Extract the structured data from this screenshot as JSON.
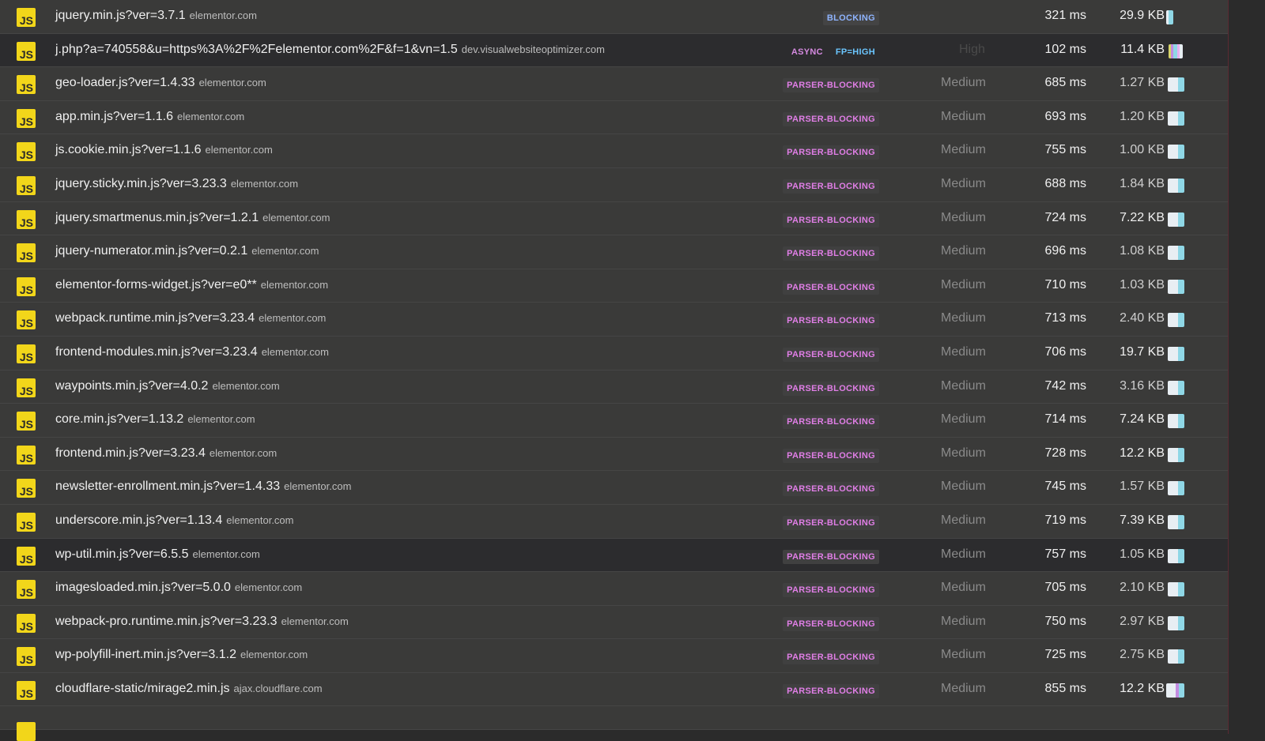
{
  "colors": {
    "js_icon": "#f2d61a",
    "blocking_badge": "#8fb4ff",
    "parser_blocking_badge": "#e07ee6",
    "async_badge": "#d58ae0",
    "fp_badge": "#6bc6ff",
    "bar_light": "#e8eef3",
    "bar_cyan": "#8fd7e6",
    "bar_accent": "#c38be0"
  },
  "icon": "js-file-icon",
  "icon_label": "JS",
  "rows": [
    {
      "name": "jquery.min.js?ver=3.7.1",
      "host": "elementor.com",
      "badges": [
        "BLOCKING"
      ],
      "priority": "",
      "time": "321 ms",
      "size": "29.9 KB",
      "bar": "cyan-thin",
      "highlight": true
    },
    {
      "name": "j.php?a=740558&u=https%3A%2F%2Felementor.com%2F&f=1&vn=1.5",
      "host": "dev.visualwebsiteoptimizer.com",
      "badges": [
        "ASYNC",
        "FP=HIGH"
      ],
      "priority": "High",
      "time": "102 ms",
      "size": "11.4 KB",
      "bar": "multi",
      "dark": true
    },
    {
      "name": "geo-loader.js?ver=1.4.33",
      "host": "elementor.com",
      "badges": [
        "PARSER-BLOCKING"
      ],
      "priority": "Medium",
      "time": "685 ms",
      "size": "1.27 KB",
      "bar": "std"
    },
    {
      "name": "app.min.js?ver=1.1.6",
      "host": "elementor.com",
      "badges": [
        "PARSER-BLOCKING"
      ],
      "priority": "Medium",
      "time": "693 ms",
      "size": "1.20 KB",
      "bar": "std"
    },
    {
      "name": "js.cookie.min.js?ver=1.1.6",
      "host": "elementor.com",
      "badges": [
        "PARSER-BLOCKING"
      ],
      "priority": "Medium",
      "time": "755 ms",
      "size": "1.00 KB",
      "bar": "std"
    },
    {
      "name": "jquery.sticky.min.js?ver=3.23.3",
      "host": "elementor.com",
      "badges": [
        "PARSER-BLOCKING"
      ],
      "priority": "Medium",
      "time": "688 ms",
      "size": "1.84 KB",
      "bar": "std"
    },
    {
      "name": "jquery.smartmenus.min.js?ver=1.2.1",
      "host": "elementor.com",
      "badges": [
        "PARSER-BLOCKING"
      ],
      "priority": "Medium",
      "time": "724 ms",
      "size": "7.22 KB",
      "bar": "std"
    },
    {
      "name": "jquery-numerator.min.js?ver=0.2.1",
      "host": "elementor.com",
      "badges": [
        "PARSER-BLOCKING"
      ],
      "priority": "Medium",
      "time": "696 ms",
      "size": "1.08 KB",
      "bar": "std"
    },
    {
      "name": "elementor-forms-widget.js?ver=e0**",
      "host": "elementor.com",
      "badges": [
        "PARSER-BLOCKING"
      ],
      "priority": "Medium",
      "time": "710 ms",
      "size": "1.03 KB",
      "bar": "std"
    },
    {
      "name": "webpack.runtime.min.js?ver=3.23.4",
      "host": "elementor.com",
      "badges": [
        "PARSER-BLOCKING"
      ],
      "priority": "Medium",
      "time": "713 ms",
      "size": "2.40 KB",
      "bar": "std"
    },
    {
      "name": "frontend-modules.min.js?ver=3.23.4",
      "host": "elementor.com",
      "badges": [
        "PARSER-BLOCKING"
      ],
      "priority": "Medium",
      "time": "706 ms",
      "size": "19.7 KB",
      "bar": "std"
    },
    {
      "name": "waypoints.min.js?ver=4.0.2",
      "host": "elementor.com",
      "badges": [
        "PARSER-BLOCKING"
      ],
      "priority": "Medium",
      "time": "742 ms",
      "size": "3.16 KB",
      "bar": "std"
    },
    {
      "name": "core.min.js?ver=1.13.2",
      "host": "elementor.com",
      "badges": [
        "PARSER-BLOCKING"
      ],
      "priority": "Medium",
      "time": "714 ms",
      "size": "7.24 KB",
      "bar": "std"
    },
    {
      "name": "frontend.min.js?ver=3.23.4",
      "host": "elementor.com",
      "badges": [
        "PARSER-BLOCKING"
      ],
      "priority": "Medium",
      "time": "728 ms",
      "size": "12.2 KB",
      "bar": "std"
    },
    {
      "name": "newsletter-enrollment.min.js?ver=1.4.33",
      "host": "elementor.com",
      "badges": [
        "PARSER-BLOCKING"
      ],
      "priority": "Medium",
      "time": "745 ms",
      "size": "1.57 KB",
      "bar": "std"
    },
    {
      "name": "underscore.min.js?ver=1.13.4",
      "host": "elementor.com",
      "badges": [
        "PARSER-BLOCKING"
      ],
      "priority": "Medium",
      "time": "719 ms",
      "size": "7.39 KB",
      "bar": "std"
    },
    {
      "name": "wp-util.min.js?ver=6.5.5",
      "host": "elementor.com",
      "badges": [
        "PARSER-BLOCKING"
      ],
      "priority": "Medium",
      "time": "757 ms",
      "size": "1.05 KB",
      "bar": "std",
      "dark": true
    },
    {
      "name": "imagesloaded.min.js?ver=5.0.0",
      "host": "elementor.com",
      "badges": [
        "PARSER-BLOCKING"
      ],
      "priority": "Medium",
      "time": "705 ms",
      "size": "2.10 KB",
      "bar": "std"
    },
    {
      "name": "webpack-pro.runtime.min.js?ver=3.23.3",
      "host": "elementor.com",
      "badges": [
        "PARSER-BLOCKING"
      ],
      "priority": "Medium",
      "time": "750 ms",
      "size": "2.97 KB",
      "bar": "std"
    },
    {
      "name": "wp-polyfill-inert.min.js?ver=3.1.2",
      "host": "elementor.com",
      "badges": [
        "PARSER-BLOCKING"
      ],
      "priority": "Medium",
      "time": "725 ms",
      "size": "2.75 KB",
      "bar": "std"
    },
    {
      "name": "cloudflare-static/mirage2.min.js",
      "host": "ajax.cloudflare.com",
      "badges": [
        "PARSER-BLOCKING"
      ],
      "priority": "Medium",
      "time": "855 ms",
      "size": "12.2 KB",
      "bar": "wide"
    }
  ]
}
